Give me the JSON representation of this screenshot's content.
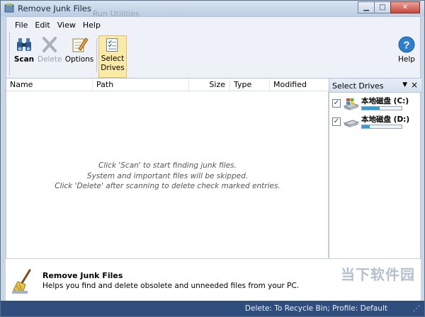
{
  "window": {
    "title": "Remove Junk Files",
    "watermark_top": "Run Utilities",
    "minimize_glyph": "▁",
    "maximize_glyph": "□",
    "close_glyph": "✕"
  },
  "menu": {
    "items": [
      "File",
      "Edit",
      "View",
      "Help"
    ]
  },
  "toolbar": {
    "scan_label": "Scan",
    "delete_label": "Delete",
    "options_label": "Options",
    "select_drives_label_1": "Select",
    "select_drives_label_2": "Drives",
    "help_label": "Help"
  },
  "table": {
    "columns": [
      "Name",
      "Path",
      "Size",
      "Type",
      "Modified"
    ],
    "hint_lines": [
      "Click 'Scan' to start finding junk files.",
      "System and important files will be skipped.",
      "Click 'Delete' after scanning to delete check marked entries."
    ]
  },
  "drives_panel": {
    "title": "Select Drives",
    "drives": [
      {
        "label": "本地磁盘 (C:)",
        "checked": true,
        "usage_percent": 45,
        "icon": "windows-drive-icon"
      },
      {
        "label": "本地磁盘 (D:)",
        "checked": true,
        "usage_percent": 20,
        "icon": "hard-drive-icon"
      }
    ]
  },
  "info": {
    "title": "Remove Junk Files",
    "description": "Helps you find and delete obsolete and unneeded files from your PC.",
    "watermark": "当下软件园"
  },
  "status": {
    "text": "Delete: To Recycle Bin; Profile: Default"
  },
  "colors": {
    "accent": "#2f4e7e",
    "selected_tool_bg": "#fbeaa6",
    "drive_usage": "#27a2dc"
  }
}
